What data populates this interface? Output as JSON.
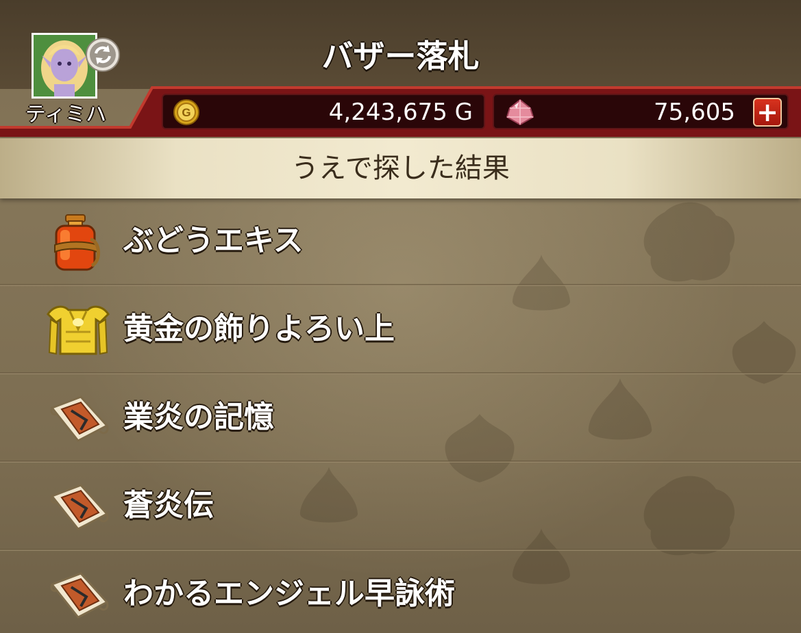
{
  "header": {
    "title": "バザー落札",
    "player_name": "ティミハ",
    "gold": "4,243,675 G",
    "gems": "75,605",
    "add_gems_label": "+"
  },
  "section": {
    "title": "うえで探した結果"
  },
  "results": [
    {
      "name": "ぶどうエキス",
      "icon": "grape-extract-bottle-icon"
    },
    {
      "name": "黄金の飾りよろい上",
      "icon": "gold-armor-icon"
    },
    {
      "name": "業炎の記憶",
      "icon": "scroll-icon"
    },
    {
      "name": "蒼炎伝",
      "icon": "scroll-icon"
    },
    {
      "name": "わかるエンジェル早詠術",
      "icon": "scroll-icon"
    }
  ],
  "colors": {
    "header_red": "#7a1416",
    "banner_cream": "#f2ead0",
    "background_brown": "#7d6e52"
  }
}
